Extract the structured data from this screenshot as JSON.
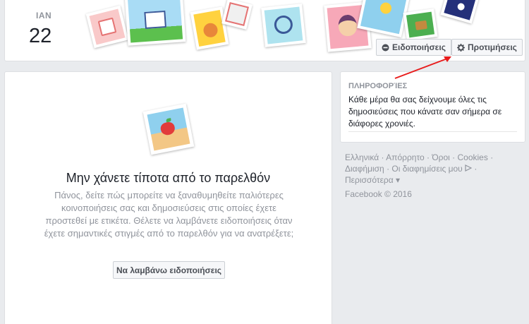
{
  "header": {
    "month": "ΙΑΝ",
    "day": "22",
    "notifications_button": "Ειδοποιήσεις",
    "preferences_button": "Προτιμήσεις"
  },
  "main": {
    "title": "Μην χάνετε τίποτα από το παρελθόν",
    "description": "Πάνος, δείτε πώς μπορείτε να ξαναθυμηθείτε παλιότερες κοινοποιήσεις σας και δημοσιεύσεις στις οποίες έχετε προστεθεί με ετικέτα. Θέλετε να λαμβάνετε ειδοποιήσεις όταν έχετε σημαντικές στιγμές από το παρελθόν για να ανατρέξετε;",
    "button_label": "Να λαμβάνω ειδοποιήσεις"
  },
  "info": {
    "title": "ΠΛΗΡΟΦΟΡΊΕΣ",
    "text": "Κάθε μέρα θα σας δείχνουμε όλες τις δημοσιεύσεις που κάνατε σαν σήμερα σε διάφορες χρονιές."
  },
  "footer": {
    "links": [
      "Ελληνικά",
      "Απόρρητο",
      "Όροι",
      "Cookies",
      "Διαφήμιση",
      "Οι διαφημίσεις μου",
      "Περισσότερα"
    ],
    "copyright": "Facebook © 2016"
  },
  "colors": {
    "accent_arrow": "#e81c1c",
    "muted_text": "#90949c"
  }
}
